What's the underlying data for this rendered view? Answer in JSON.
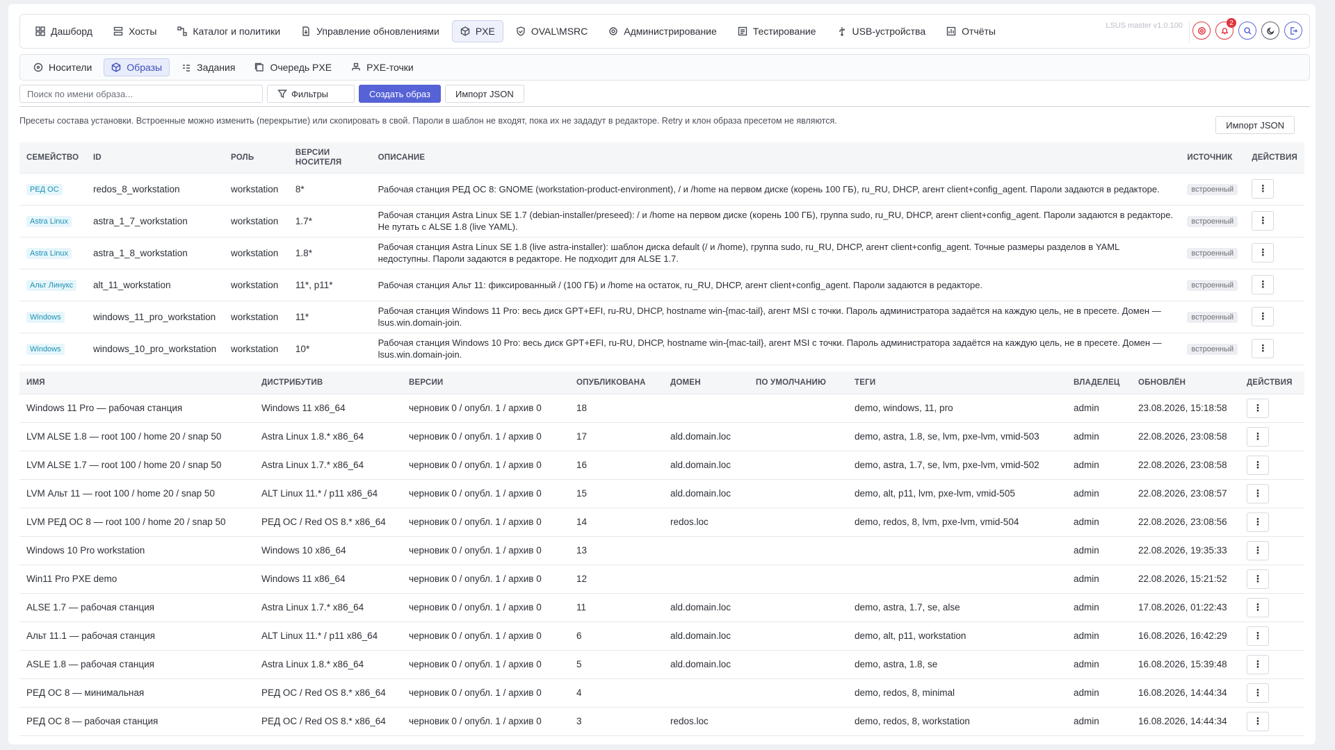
{
  "nav": {
    "items": [
      {
        "label": "Дашборд",
        "icon": "dashboard-icon"
      },
      {
        "label": "Хосты",
        "icon": "hosts-icon"
      },
      {
        "label": "Каталог и политики",
        "icon": "catalog-icon"
      },
      {
        "label": "Управление обновлениями",
        "icon": "updates-icon"
      },
      {
        "label": "PXE",
        "icon": "pxe-icon",
        "active": true
      },
      {
        "label": "OVAL\\MSRC",
        "icon": "shield-icon"
      },
      {
        "label": "Администрирование",
        "icon": "admin-icon"
      },
      {
        "label": "Тестирование",
        "icon": "testing-icon"
      },
      {
        "label": "USB-устройства",
        "icon": "usb-icon"
      },
      {
        "label": "Отчёты",
        "icon": "reports-icon"
      }
    ],
    "version": "LSUS master v1.0.100",
    "notification_count": "2"
  },
  "subnav": {
    "items": [
      {
        "label": "Носители",
        "icon": "media-icon"
      },
      {
        "label": "Образы",
        "icon": "images-icon",
        "active": true
      },
      {
        "label": "Задания",
        "icon": "tasks-icon"
      },
      {
        "label": "Очередь PXE",
        "icon": "queue-icon"
      },
      {
        "label": "PXE-точки",
        "icon": "pxe-points-icon"
      }
    ]
  },
  "toolbar": {
    "search_placeholder": "Поиск по имени образа...",
    "filters_label": "Фильтры",
    "create_label": "Создать образ",
    "import_label": "Импорт JSON"
  },
  "hint": "Пресеты состава установки. Встроенные можно изменить (перекрытие) или скопировать в свой. Пароли в шаблон не входят, пока их не зададут в редакторе. Retry и клон образа пресетом не являются.",
  "import_right_label": "Импорт JSON",
  "presets": {
    "headers": [
      "Семейство",
      "ID",
      "Роль",
      "Версии носителя",
      "Описание",
      "Источник",
      "Действия"
    ],
    "rows": [
      {
        "family": "РЕД ОС",
        "id": "redos_8_workstation",
        "role": "workstation",
        "versions": "8*",
        "description": "Рабочая станция РЕД ОС 8: GNOME (workstation-product-environment), / и /home на первом диске (корень 100 ГБ), ru_RU, DHCP, агент client+config_agent. Пароли задаются в редакторе.",
        "source": "встроенный"
      },
      {
        "family": "Astra Linux",
        "id": "astra_1_7_workstation",
        "role": "workstation",
        "versions": "1.7*",
        "description": "Рабочая станция Astra Linux SE 1.7 (debian-installer/preseed): / и /home на первом диске (корень 100 ГБ), группа sudo, ru_RU, DHCP, агент client+config_agent. Пароли задаются в редакторе. Не путать с ALSE 1.8 (live YAML).",
        "source": "встроенный"
      },
      {
        "family": "Astra Linux",
        "id": "astra_1_8_workstation",
        "role": "workstation",
        "versions": "1.8*",
        "description": "Рабочая станция Astra Linux SE 1.8 (live astra-installer): шаблон диска default (/ и /home), группа sudo, ru_RU, DHCP, агент client+config_agent. Точные размеры разделов в YAML недоступны. Пароли задаются в редакторе. Не подходит для ALSE 1.7.",
        "source": "встроенный"
      },
      {
        "family": "Альт Линукс",
        "id": "alt_11_workstation",
        "role": "workstation",
        "versions": "11*, p11*",
        "description": "Рабочая станция Альт 11: фиксированный / (100 ГБ) и /home на остаток, ru_RU, DHCP, агент client+config_agent. Пароли задаются в редакторе.",
        "source": "встроенный"
      },
      {
        "family": "Windows",
        "id": "windows_11_pro_workstation",
        "role": "workstation",
        "versions": "11*",
        "description": "Рабочая станция Windows 11 Pro: весь диск GPT+EFI, ru-RU, DHCP, hostname win-{mac-tail}, агент MSI с точки. Пароль администратора задаётся на каждую цель, не в пресете. Домен — lsus.win.domain-join.",
        "source": "встроенный"
      },
      {
        "family": "Windows",
        "id": "windows_10_pro_workstation",
        "role": "workstation",
        "versions": "10*",
        "description": "Рабочая станция Windows 10 Pro: весь диск GPT+EFI, ru-RU, DHCP, hostname win-{mac-tail}, агент MSI с точки. Пароль администратора задаётся на каждую цель, не в пресете. Домен — lsus.win.domain-join.",
        "source": "встроенный"
      }
    ]
  },
  "images": {
    "headers": [
      "Имя",
      "Дистрибутив",
      "Версии",
      "Опубликована",
      "Домен",
      "По умолчанию",
      "Теги",
      "Владелец",
      "Обновлён",
      "Действия"
    ],
    "rows": [
      {
        "name": "Windows 11 Pro — рабочая станция",
        "distro": "Windows 11 x86_64",
        "versions": "черновик 0 / опубл. 1 / архив 0",
        "published": "18",
        "domain": "",
        "default": "",
        "tags": "demo, windows, 11, pro",
        "owner": "admin",
        "updated": "23.08.2026, 15:18:58"
      },
      {
        "name": "LVM ALSE 1.8 — root 100 / home 20 / snap 50",
        "distro": "Astra Linux 1.8.* x86_64",
        "versions": "черновик 0 / опубл. 1 / архив 0",
        "published": "17",
        "domain": "ald.domain.loc",
        "default": "",
        "tags": "demo, astra, 1.8, se, lvm, pxe-lvm, vmid-503",
        "owner": "admin",
        "updated": "22.08.2026, 23:08:58"
      },
      {
        "name": "LVM ALSE 1.7 — root 100 / home 20 / snap 50",
        "distro": "Astra Linux 1.7.* x86_64",
        "versions": "черновик 0 / опубл. 1 / архив 0",
        "published": "16",
        "domain": "ald.domain.loc",
        "default": "",
        "tags": "demo, astra, 1.7, se, lvm, pxe-lvm, vmid-502",
        "owner": "admin",
        "updated": "22.08.2026, 23:08:58"
      },
      {
        "name": "LVM Альт 11 — root 100 / home 20 / snap 50",
        "distro": "ALT Linux 11.* / p11 x86_64",
        "versions": "черновик 0 / опубл. 1 / архив 0",
        "published": "15",
        "domain": "ald.domain.loc",
        "default": "",
        "tags": "demo, alt, p11, lvm, pxe-lvm, vmid-505",
        "owner": "admin",
        "updated": "22.08.2026, 23:08:57"
      },
      {
        "name": "LVM РЕД ОС 8 — root 100 / home 20 / snap 50",
        "distro": "РЕД ОС / Red OS 8.* x86_64",
        "versions": "черновик 0 / опубл. 1 / архив 0",
        "published": "14",
        "domain": "redos.loc",
        "default": "",
        "tags": "demo, redos, 8, lvm, pxe-lvm, vmid-504",
        "owner": "admin",
        "updated": "22.08.2026, 23:08:56"
      },
      {
        "name": "Windows 10 Pro workstation",
        "distro": "Windows 10 x86_64",
        "versions": "черновик 0 / опубл. 1 / архив 0",
        "published": "13",
        "domain": "",
        "default": "",
        "tags": "",
        "owner": "admin",
        "updated": "22.08.2026, 19:35:33"
      },
      {
        "name": "Win11 Pro PXE demo",
        "distro": "Windows 11 x86_64",
        "versions": "черновик 0 / опубл. 1 / архив 0",
        "published": "12",
        "domain": "",
        "default": "",
        "tags": "",
        "owner": "admin",
        "updated": "22.08.2026, 15:21:52"
      },
      {
        "name": "ALSE 1.7 — рабочая станция",
        "distro": "Astra Linux 1.7.* x86_64",
        "versions": "черновик 0 / опубл. 1 / архив 0",
        "published": "11",
        "domain": "ald.domain.loc",
        "default": "",
        "tags": "demo, astra, 1.7, se, alse",
        "owner": "admin",
        "updated": "17.08.2026, 01:22:43"
      },
      {
        "name": "Альт 11.1 — рабочая станция",
        "distro": "ALT Linux 11.* / p11 x86_64",
        "versions": "черновик 0 / опубл. 1 / архив 0",
        "published": "6",
        "domain": "ald.domain.loc",
        "default": "",
        "tags": "demo, alt, p11, workstation",
        "owner": "admin",
        "updated": "16.08.2026, 16:42:29"
      },
      {
        "name": "ASLE 1.8 — рабочая станция",
        "distro": "Astra Linux 1.8.* x86_64",
        "versions": "черновик 0 / опубл. 1 / архив 0",
        "published": "5",
        "domain": "ald.domain.loc",
        "default": "",
        "tags": "demo, astra, 1.8, se",
        "owner": "admin",
        "updated": "16.08.2026, 15:39:48"
      },
      {
        "name": "РЕД ОС 8 — минимальная",
        "distro": "РЕД ОС / Red OS 8.* x86_64",
        "versions": "черновик 0 / опубл. 1 / архив 0",
        "published": "4",
        "domain": "",
        "default": "",
        "tags": "demo, redos, 8, minimal",
        "owner": "admin",
        "updated": "16.08.2026, 14:44:34"
      },
      {
        "name": "РЕД ОС 8 — рабочая станция",
        "distro": "РЕД ОС / Red OS 8.* x86_64",
        "versions": "черновик 0 / опубл. 1 / архив 0",
        "published": "3",
        "domain": "redos.loc",
        "default": "",
        "tags": "demo, redos, 8, workstation",
        "owner": "admin",
        "updated": "16.08.2026, 14:44:34"
      }
    ]
  }
}
